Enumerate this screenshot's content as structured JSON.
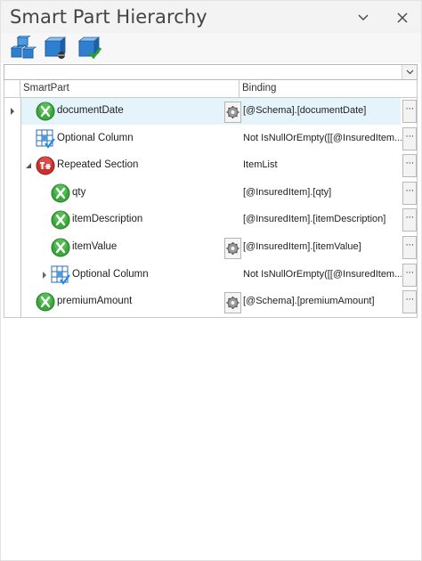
{
  "window": {
    "title": "Smart Part Hierarchy"
  },
  "toolbar": {
    "tools": [
      {
        "icon": "hierarchy-cubes-icon"
      },
      {
        "icon": "cube-connect-icon"
      },
      {
        "icon": "cube-validate-icon"
      }
    ]
  },
  "combo": {
    "value": ""
  },
  "grid": {
    "columns": {
      "smartpart": "SmartPart",
      "binding": "Binding"
    },
    "ellipsis": "···",
    "rows": [
      {
        "label": "documentDate",
        "binding": "[@Schema].[documentDate]",
        "icon": "field-x-icon",
        "depth": 1,
        "expander": "collapsed-arrow",
        "gear": true,
        "selected": true
      },
      {
        "label": "Optional Column",
        "binding": "Not IsNullOrEmpty([[@InsuredItem...",
        "icon": "optional-column-icon",
        "depth": 1,
        "expander": "none",
        "gear": false,
        "selected": false
      },
      {
        "label": "Repeated Section",
        "binding": "ItemList",
        "icon": "repeated-section-icon",
        "depth": 1,
        "expander": "expanded",
        "gear": false,
        "selected": false
      },
      {
        "label": "qty",
        "binding": "[@InsuredItem].[qty]",
        "icon": "field-x-icon",
        "depth": 2,
        "expander": "none",
        "gear": false,
        "selected": false
      },
      {
        "label": "itemDescription",
        "binding": "[@InsuredItem].[itemDescription]",
        "icon": "field-x-icon",
        "depth": 2,
        "expander": "none",
        "gear": false,
        "selected": false
      },
      {
        "label": "itemValue",
        "binding": "[@InsuredItem].[itemValue]",
        "icon": "field-x-icon",
        "depth": 2,
        "expander": "none",
        "gear": true,
        "selected": false
      },
      {
        "label": "Optional Column",
        "binding": "Not IsNullOrEmpty([[@InsuredItem...",
        "icon": "optional-column-icon",
        "depth": 2,
        "expander": "collapsed",
        "gear": false,
        "selected": false
      },
      {
        "label": "premiumAmount",
        "binding": "[@Schema].[premiumAmount]",
        "icon": "field-x-icon",
        "depth": 1,
        "expander": "none",
        "gear": true,
        "selected": false
      }
    ]
  },
  "colors": {
    "selection": "#e5f3fb",
    "field_icon": "#3aa83a",
    "repeated_icon": "#c9302c",
    "toolbar_cube": "#2a7fd4"
  }
}
